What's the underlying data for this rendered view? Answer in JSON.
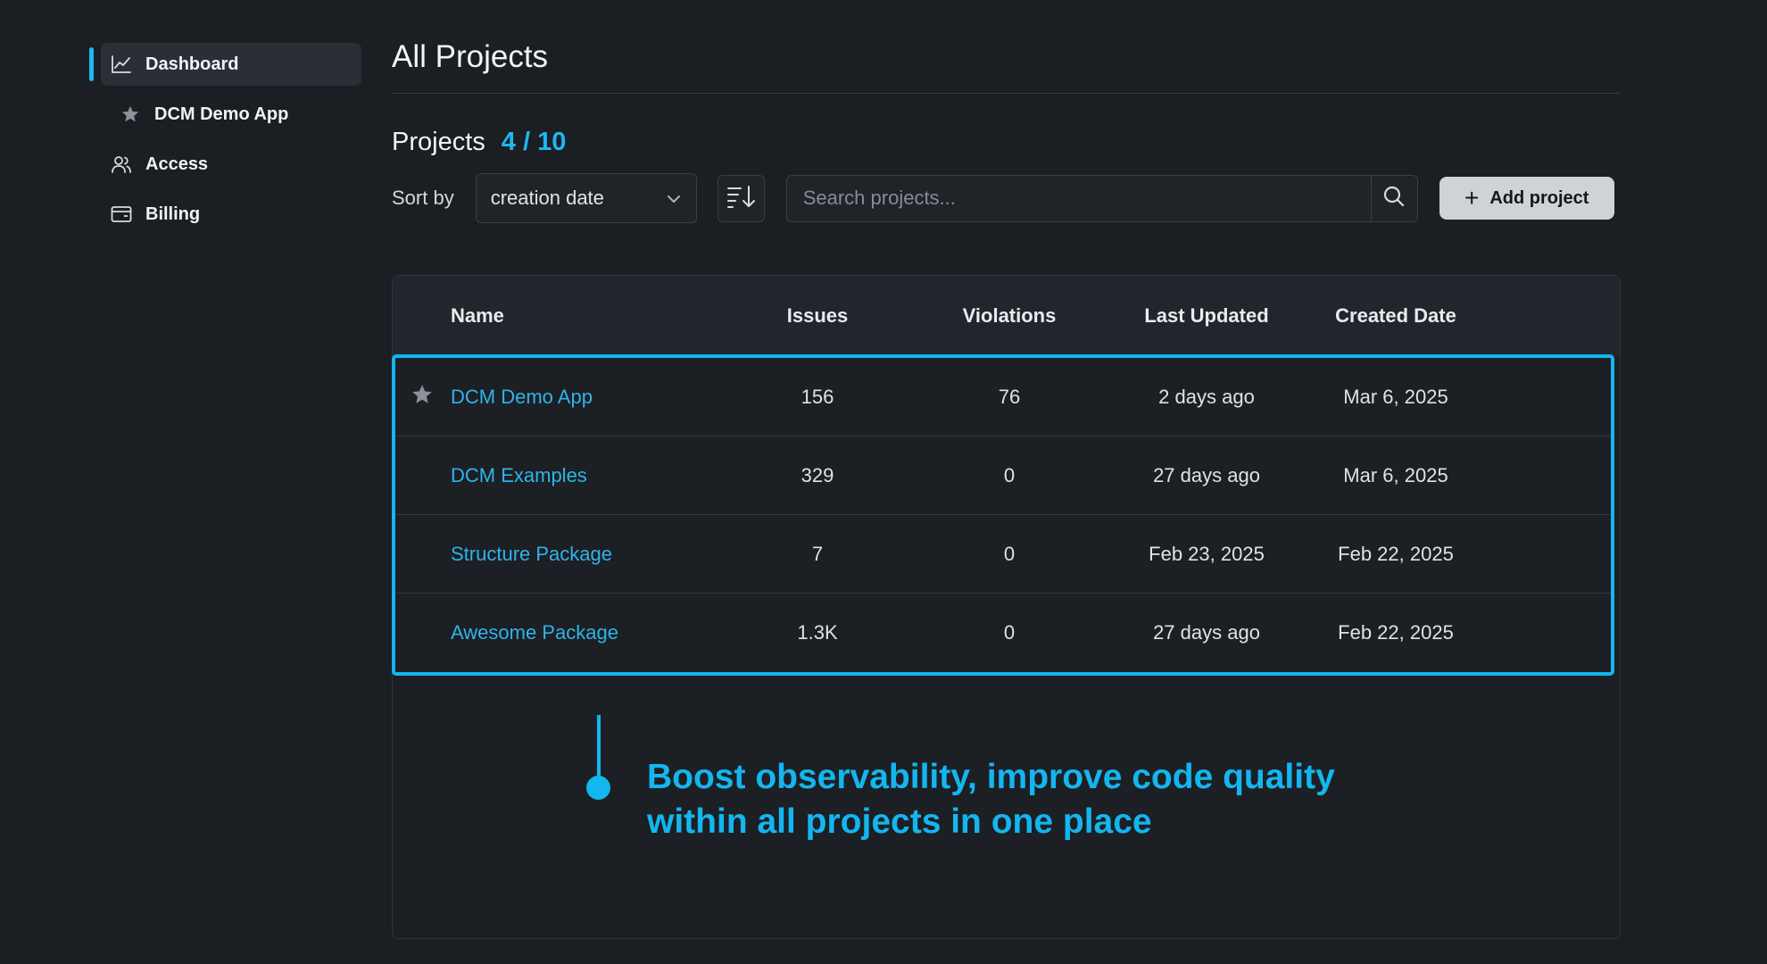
{
  "sidebar": {
    "items": [
      {
        "label": "Dashboard",
        "icon": "chart-line-icon",
        "active": true
      },
      {
        "label": "DCM Demo App",
        "icon": "star-icon"
      },
      {
        "label": "Access",
        "icon": "users-icon"
      },
      {
        "label": "Billing",
        "icon": "wallet-icon"
      }
    ]
  },
  "page": {
    "title": "All Projects"
  },
  "projects": {
    "label": "Projects",
    "count": "4 / 10"
  },
  "toolbar": {
    "sort_label": "Sort by",
    "sort_value": "creation date",
    "search_placeholder": "Search projects...",
    "add_label": "Add project"
  },
  "table": {
    "headers": [
      "Name",
      "Issues",
      "Violations",
      "Last Updated",
      "Created Date"
    ],
    "rows": [
      {
        "name": "DCM Demo App",
        "issues": "156",
        "violations": "76",
        "updated": "2 days ago",
        "created": "Mar 6, 2025",
        "starred": true
      },
      {
        "name": "DCM Examples",
        "issues": "329",
        "violations": "0",
        "updated": "27 days ago",
        "created": "Mar 6, 2025",
        "starred": false
      },
      {
        "name": "Structure Package",
        "issues": "7",
        "violations": "0",
        "updated": "Feb 23, 2025",
        "created": "Feb 22, 2025",
        "starred": false
      },
      {
        "name": "Awesome Package",
        "issues": "1.3K",
        "violations": "0",
        "updated": "27 days ago",
        "created": "Feb 22, 2025",
        "starred": false
      }
    ]
  },
  "callout": {
    "line1": "Boost observability, improve code quality",
    "line2": "within all projects in one place"
  },
  "colors": {
    "accent": "#13b6ef",
    "background": "#1b1e23",
    "link": "#2fb3e8"
  }
}
